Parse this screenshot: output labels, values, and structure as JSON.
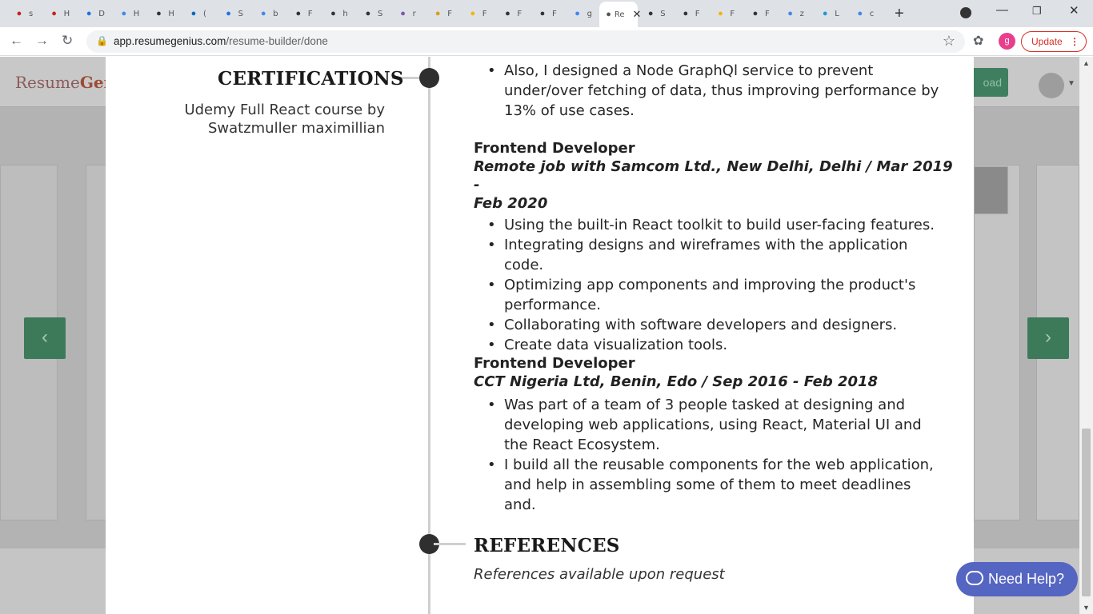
{
  "browser": {
    "tabs": [
      {
        "icon": "gmail-icon",
        "label": "s",
        "color": "#c5221f"
      },
      {
        "icon": "gmail-icon",
        "label": "H",
        "color": "#c5221f"
      },
      {
        "icon": "download-icon",
        "label": "D",
        "color": "#1a73e8"
      },
      {
        "icon": "google-icon",
        "label": "H",
        "color": "#4285f4"
      },
      {
        "icon": "github-icon",
        "label": "H",
        "color": "#333333"
      },
      {
        "icon": "linkedin-icon",
        "label": "(",
        "color": "#0a66c2"
      },
      {
        "icon": "w-icon",
        "label": "S",
        "color": "#1a73e8"
      },
      {
        "icon": "google-icon",
        "label": "b",
        "color": "#4285f4"
      },
      {
        "icon": "bird-icon",
        "label": "F",
        "color": "#333333"
      },
      {
        "icon": "bird-icon",
        "label": "h",
        "color": "#333333"
      },
      {
        "icon": "bird-icon",
        "label": "S",
        "color": "#333333"
      },
      {
        "icon": "woo-icon",
        "label": "r",
        "color": "#7f54b3"
      },
      {
        "icon": "sun-icon",
        "label": "F",
        "color": "#d4a017"
      },
      {
        "icon": "h-icon",
        "label": "F",
        "color": "#f4b400"
      },
      {
        "icon": "github-icon",
        "label": "F",
        "color": "#333333"
      },
      {
        "icon": "github-icon",
        "label": "F",
        "color": "#333333"
      },
      {
        "icon": "google-icon",
        "label": "g",
        "color": "#4285f4"
      },
      {
        "icon": "resume-icon",
        "label": "Re",
        "color": "#555555",
        "active": true
      },
      {
        "icon": "github-icon",
        "label": "S",
        "color": "#333333"
      },
      {
        "icon": "github-icon",
        "label": "F",
        "color": "#333333"
      },
      {
        "icon": "folder-icon",
        "label": "F",
        "color": "#f4b400"
      },
      {
        "icon": "flag-icon",
        "label": "F",
        "color": "#333333"
      },
      {
        "icon": "google-icon",
        "label": "z",
        "color": "#4285f4"
      },
      {
        "icon": "m-icon",
        "label": "L",
        "color": "#1a9ad6"
      },
      {
        "icon": "google-icon",
        "label": "c",
        "color": "#4285f4"
      }
    ],
    "url_host": "app.resumegenius.com",
    "url_path": "/resume-builder/done",
    "profile_initial": "g",
    "update_label": "Update"
  },
  "app": {
    "logo_prefix": "Resume",
    "logo_bold": "Gen",
    "download_partial": "oad",
    "help_label": "Need Help?"
  },
  "resume": {
    "certifications": {
      "title": "CERTIFICATIONS",
      "lines": [
        "Udemy Full React course by",
        "Swatzmuller maximillian"
      ]
    },
    "top_bullet": [
      "Also, I designed a Node GraphQl service to prevent",
      "under/over fetching of data, thus improving performance by",
      "13% of use cases."
    ],
    "jobs": [
      {
        "title": "Frontend Developer",
        "subtitle_lines": [
          "Remote job with Samcom Ltd., New Delhi, Delhi / Mar 2019 -",
          "Feb 2020"
        ],
        "bullets": [
          [
            "Using the built-in React toolkit to build user-facing features."
          ],
          [
            "Integrating designs and wireframes with the application",
            "code."
          ],
          [
            "Optimizing app components and improving the product's",
            "performance."
          ],
          [
            "Collaborating with software developers and designers."
          ],
          [
            "Create data visualization tools."
          ]
        ]
      },
      {
        "title": "Frontend Developer",
        "subtitle_lines": [
          "CCT Nigeria Ltd, Benin, Edo / Sep 2016 - Feb 2018"
        ],
        "bullets": [
          [
            "Was part of a team of 3 people tasked at designing and",
            "developing web applications, using React, Material UI and",
            "the React Ecosystem."
          ],
          [
            "I build all the reusable components for the web application,",
            "and help in assembling some of them to meet deadlines",
            "and."
          ]
        ]
      }
    ],
    "references": {
      "title": "REFERENCES",
      "text": "References available upon request"
    }
  }
}
